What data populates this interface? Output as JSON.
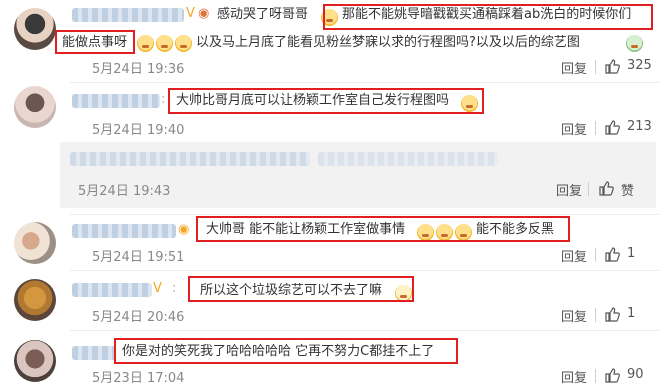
{
  "comments": [
    {
      "text_part1": "感动哭了呀哥哥",
      "text_part2": "那能不能姚导暗戳戳买通稿踩着ab洗白的时候你们",
      "text_line2_a": "能做点事呀",
      "text_line2_b": "以及马上月底了能看见粉丝梦寐以求的行程图吗?以及以后的综艺图",
      "time": "5月24日 19:36",
      "reply": "回复",
      "likes": "325"
    },
    {
      "text": "大帅比哥月底可以让杨颖工作室自己发行程图吗",
      "time": "5月24日 19:40",
      "reply": "回复",
      "likes": "213"
    },
    {
      "time": "5月24日 19:43",
      "reply": "回复",
      "likes": "赞"
    },
    {
      "text": "大帅哥 能不能让杨颖工作室做事情",
      "text_tail": "能不能多反黑",
      "time": "5月24日 19:51",
      "reply": "回复",
      "likes": "1"
    },
    {
      "text": "所以这个垃圾综艺可以不去了嘛",
      "time": "5月24日 20:46",
      "reply": "回复",
      "likes": "1"
    },
    {
      "text": "你是对的笑死我了哈哈哈哈哈 它再不努力C都挂不上了",
      "time": "5月23日 17:04",
      "reply": "回复",
      "likes": "90"
    }
  ]
}
